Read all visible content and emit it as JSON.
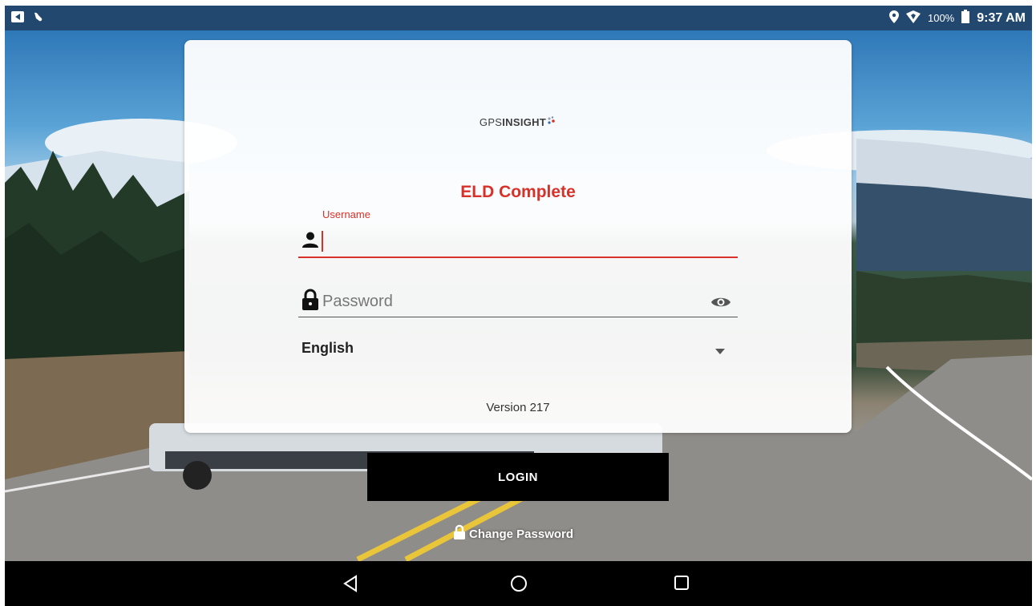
{
  "status_bar": {
    "left_icons": [
      "notification-icon",
      "hand-icon"
    ],
    "right_icons": [
      "location-icon",
      "shield-icon",
      "battery-icon"
    ],
    "battery": "100%",
    "time": "9:37 AM"
  },
  "card": {
    "logo_light": "GPS",
    "logo_bold": "INSIGHT",
    "app_title": "ELD Complete",
    "username_label": "Username",
    "username_value": "",
    "password_placeholder": "Password",
    "language": "English",
    "version": "Version 217"
  },
  "actions": {
    "login_label": "LOGIN",
    "change_password_label": "Change Password"
  },
  "nav": {
    "back": "back-icon",
    "home": "home-icon",
    "recents": "recents-icon"
  },
  "colors": {
    "accent": "#d8312a",
    "status_bar": "#23486f",
    "button": "#000000"
  }
}
